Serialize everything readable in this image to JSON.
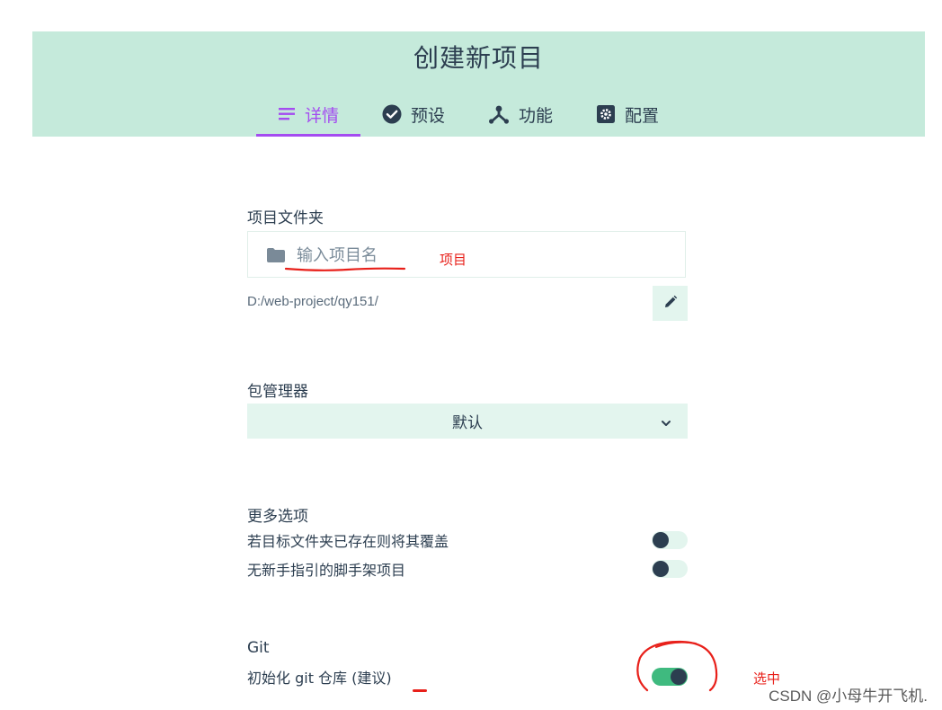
{
  "header": {
    "title": "创建新项目",
    "tabs": [
      {
        "label": "详情",
        "icon": "list-icon",
        "active": true
      },
      {
        "label": "预设",
        "icon": "check-circle-icon",
        "active": false
      },
      {
        "label": "功能",
        "icon": "fork-icon",
        "active": false
      },
      {
        "label": "配置",
        "icon": "gear-icon",
        "active": false
      }
    ]
  },
  "project_folder": {
    "label": "项目文件夹",
    "placeholder": "输入项目名",
    "value": "",
    "path": "D:/web-project/qy151/",
    "annotation": "项目"
  },
  "package_manager": {
    "label": "包管理器",
    "selected": "默认"
  },
  "more_options": {
    "label": "更多选项",
    "items": [
      {
        "label": "若目标文件夹已存在则将其覆盖",
        "on": false
      },
      {
        "label": "无新手指引的脚手架项目",
        "on": false
      }
    ]
  },
  "git": {
    "label": "Git",
    "init_label": "初始化 git 仓库 (建议)",
    "on": true,
    "annotation": "选中"
  },
  "watermark": "CSDN @小母牛开飞机.",
  "colors": {
    "header_bg": "#c5eadb",
    "accent": "#a44cf0",
    "toggle_on": "#3fba7f",
    "soft_green": "#e3f5ee",
    "annotation_red": "#e8201a"
  }
}
